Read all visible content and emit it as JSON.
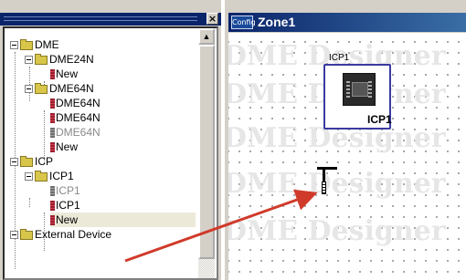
{
  "tree": {
    "close_glyph": "×",
    "scroll_up_glyph": "▲",
    "items": [
      {
        "label": "DME",
        "kind": "folder",
        "expanded": true
      },
      {
        "label": "DME24N",
        "kind": "folder",
        "expanded": true
      },
      {
        "label": "New",
        "kind": "device"
      },
      {
        "label": "DME64N",
        "kind": "folder",
        "expanded": true
      },
      {
        "label": "DME64N",
        "kind": "device"
      },
      {
        "label": "DME64N",
        "kind": "device"
      },
      {
        "label": "DME64N",
        "kind": "device",
        "dim": true
      },
      {
        "label": "New",
        "kind": "device"
      },
      {
        "label": "ICP",
        "kind": "folder",
        "expanded": true
      },
      {
        "label": "ICP1",
        "kind": "folder",
        "expanded": true
      },
      {
        "label": "ICP1",
        "kind": "device",
        "dim": true
      },
      {
        "label": "ICP1",
        "kind": "device"
      },
      {
        "label": "New",
        "kind": "device",
        "selected": true
      },
      {
        "label": "External Device",
        "kind": "folder",
        "expanded": false
      }
    ]
  },
  "zone": {
    "icon_label": "Config",
    "title": "Zone1",
    "watermark": "DME Designer",
    "block": {
      "top_label": "ICP1",
      "device_label": "ICP1"
    }
  },
  "colors": {
    "title_bar": "#0a246a",
    "drag_arrow": "#d03a2a",
    "block_border": "#3a3aa0"
  },
  "icons": {
    "expander": "minus-box-icon",
    "folder": "folder-icon",
    "device": "device-icon",
    "drop_cursor": "drop-cursor-icon"
  }
}
